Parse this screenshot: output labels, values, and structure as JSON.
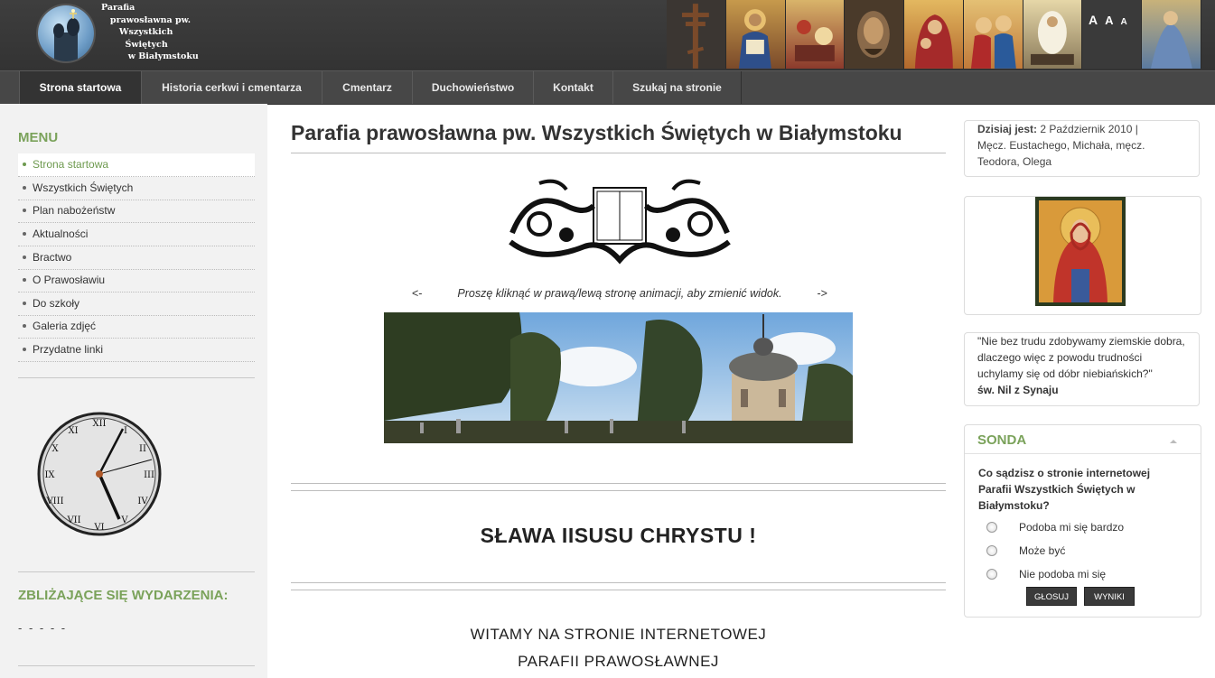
{
  "header": {
    "logo_text": "Parafia\n   prawosławna pw.\n      Wszystkich\n        Świętych\n         w Białymstoku",
    "font_controls": [
      "A",
      "A",
      "A"
    ]
  },
  "nav": {
    "items": [
      {
        "label": "Strona startowa"
      },
      {
        "label": "Historia cerkwi i cmentarza"
      },
      {
        "label": "Cmentarz"
      },
      {
        "label": "Duchowieństwo"
      },
      {
        "label": "Kontakt"
      },
      {
        "label": "Szukaj na stronie"
      }
    ]
  },
  "sidebar": {
    "menu_title": "MENU",
    "menu": [
      {
        "label": "Strona startowa"
      },
      {
        "label": "Wszystkich Świętych"
      },
      {
        "label": "Plan nabożeństw"
      },
      {
        "label": "Aktualności"
      },
      {
        "label": "Bractwo"
      },
      {
        "label": "O Prawosławiu"
      },
      {
        "label": "Do szkoły"
      },
      {
        "label": "Galeria zdjęć"
      },
      {
        "label": "Przydatne linki"
      }
    ],
    "events_title": "ZBLIŻAJĄCE SIĘ WYDARZENIA:",
    "events_placeholder": "- - - - -"
  },
  "main": {
    "title": "Parafia prawosławna pw. Wszystkich Świętych w Białymstoku",
    "anim_prev": "<-",
    "anim_hint": "Proszę kliknąć w prawą/lewą stronę animacji, aby zmienić widok.",
    "anim_next": "->",
    "slogan": "SŁAWA IISUSU CHRYSTU !",
    "welcome_1": "WITAMY NA STRONIE INTERNETOWEJ",
    "welcome_2": "PARAFII PRAWOSŁAWNEJ"
  },
  "right": {
    "date_label": "Dzisiaj jest:",
    "date_value": " 2 Październik 2010   |",
    "saints": "Męcz. Eustachego, Michała, męcz. Teodora, Olega",
    "quote": "\"Nie bez trudu zdobywamy ziemskie dobra, dlaczego więc z powodu trudności uchylamy się od dóbr niebiańskich?\"",
    "quote_author": "św. Nil z Synaju",
    "poll_title": "SONDA",
    "poll_question": "Co sądzisz o stronie internetowej Parafii Wszystkich Świętych w Białymstoku?",
    "poll_options": [
      "Podoba mi się bardzo",
      "Może być",
      "Nie podoba mi się"
    ],
    "vote_button": "GŁOSUJ",
    "results_button": "WYNIKI"
  },
  "colors": {
    "accent_green": "#7aa25a",
    "header_bg": "#3a3a3a",
    "nav_bg": "#474747"
  }
}
